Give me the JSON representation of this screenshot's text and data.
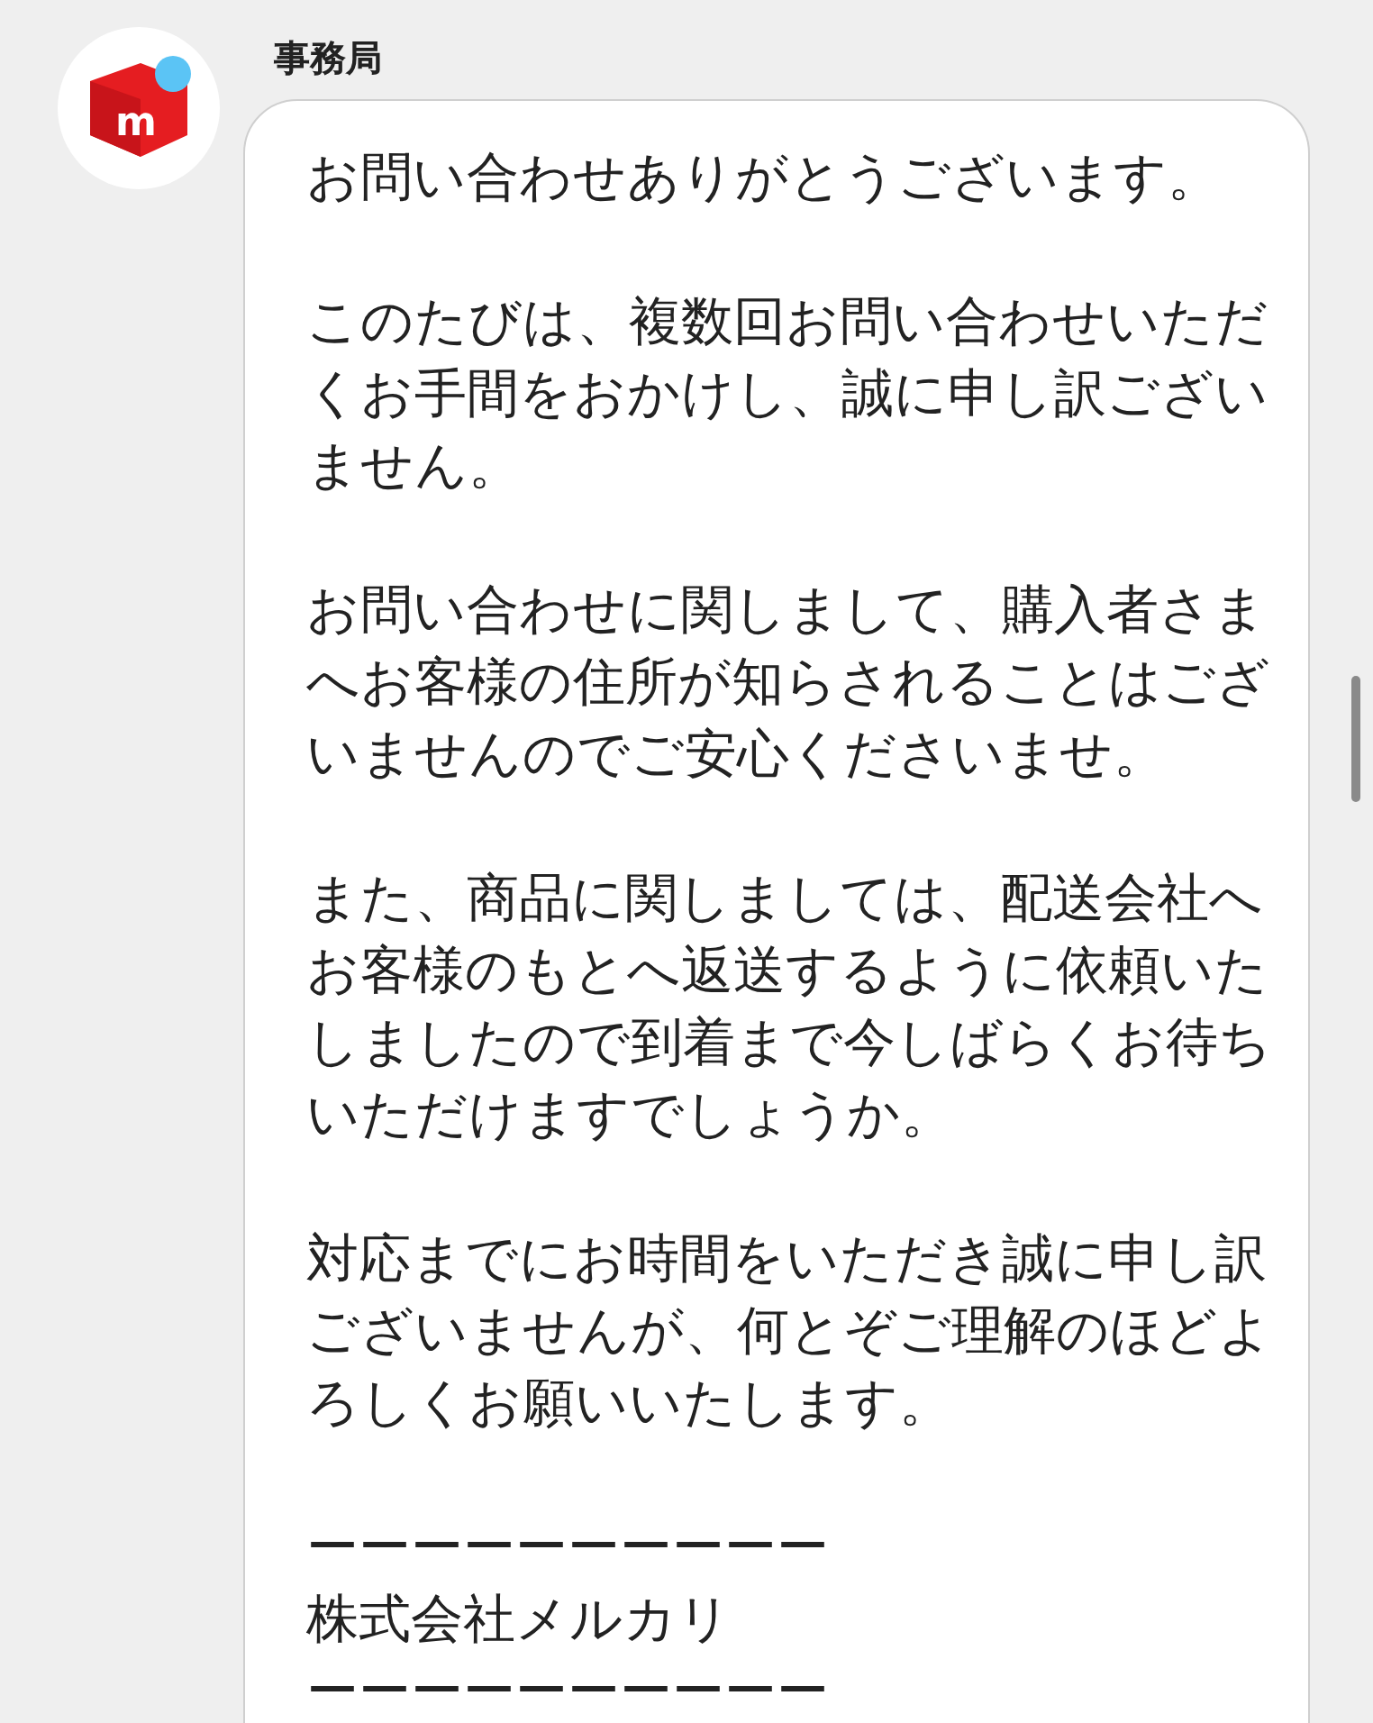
{
  "sender": {
    "name": "事務局",
    "logo_letter": "m"
  },
  "message": {
    "paragraphs": [
      "お問い合わせありがとうございます。",
      "このたびは、複数回お問い合わせいただくお手間をおかけし、誠に申し訳ございません。",
      "お問い合わせに関しまして、購入者さまへお客様の住所が知らされることはございませんのでご安心くださいませ。",
      "また、商品に関しましては、配送会社へお客様のもとへ返送するように依頼いたしましたので到着まで今しばらくお待ちいただけますでしょうか。",
      "対応までにお時間をいただき誠に申し訳ございませんが、何とぞご理解のほどよろしくお願いいたします。",
      "ーーーーーーーーーー",
      "株式会社メルカリ",
      "ーーーーーーーーーー"
    ]
  }
}
